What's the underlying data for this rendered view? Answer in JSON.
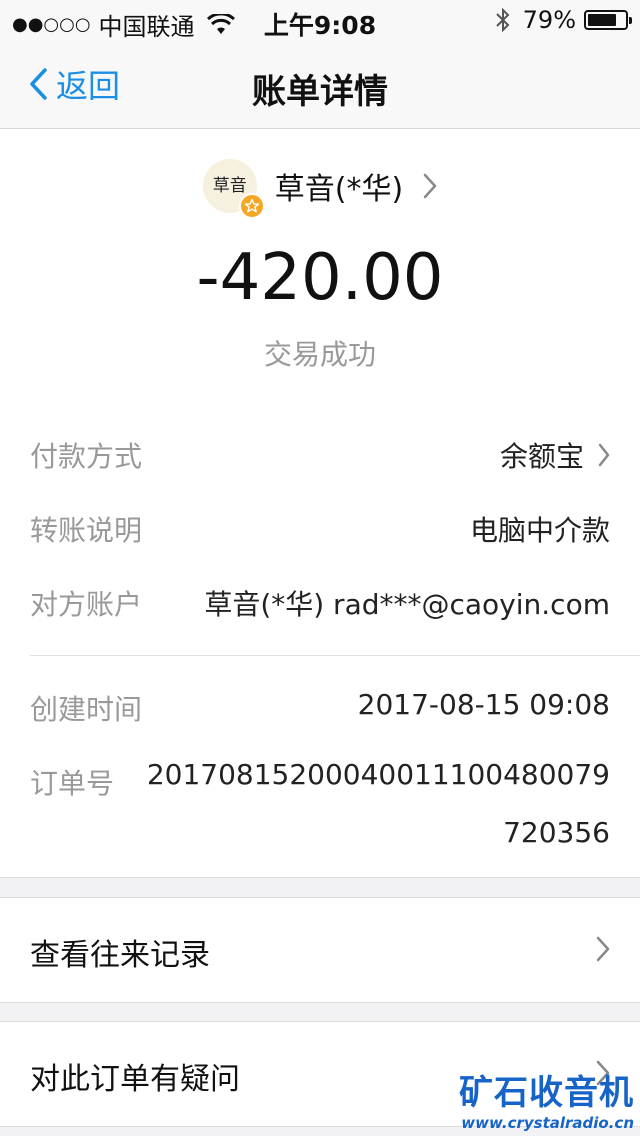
{
  "status_bar": {
    "signal": "●●○○○",
    "carrier": "中国联通",
    "time": "上午9:08",
    "battery_percent": "79%",
    "battery_level": 0.79
  },
  "nav": {
    "back_label": "返回",
    "title": "账单详情"
  },
  "payee": {
    "avatar_text": "草音",
    "name": "草音(*华)"
  },
  "transaction": {
    "amount": "-420.00",
    "status": "交易成功"
  },
  "details": [
    {
      "label": "付款方式",
      "value": "余额宝"
    },
    {
      "label": "转账说明",
      "value": "电脑中介款"
    },
    {
      "label": "对方账户",
      "value": "草音(*华) rad***@caoyin.com"
    },
    {
      "label": "创建时间",
      "value": "2017-08-15 09:08"
    },
    {
      "label": "订单号",
      "value_line1": "2017081520004001110048007​9",
      "value_line2": "720356"
    }
  ],
  "actions": [
    {
      "label": "查看往来记录"
    },
    {
      "label": "对此订单有疑问"
    }
  ],
  "watermark": {
    "title": "矿石收音机",
    "url": "www.crystalradio.cn"
  },
  "colors": {
    "accent": "#1b8ee5",
    "badge": "#f5a623",
    "watermark": "#1664c8"
  }
}
